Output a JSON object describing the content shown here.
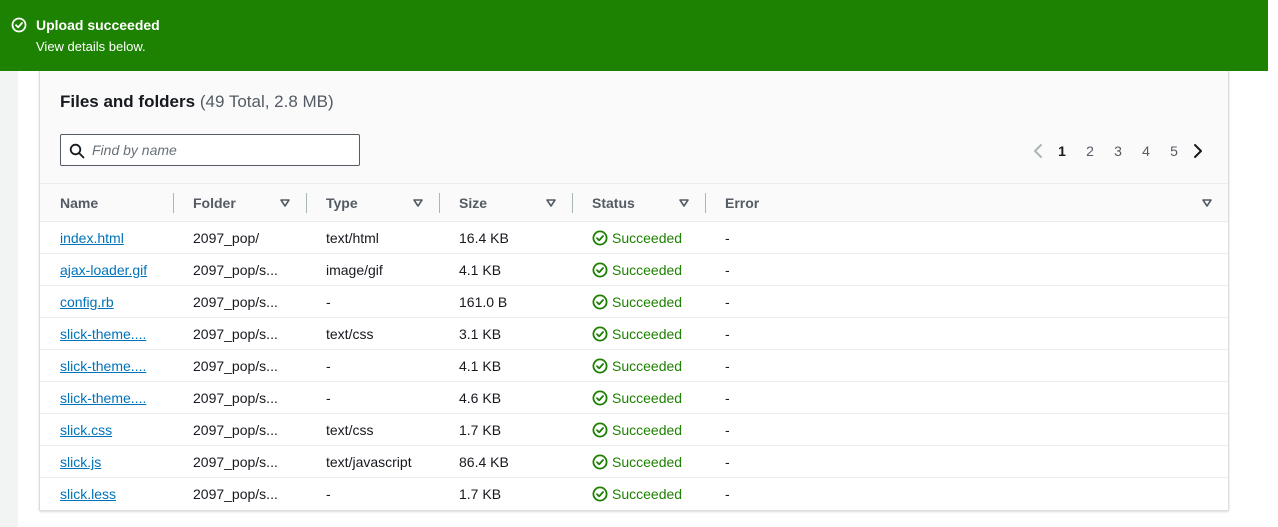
{
  "flash": {
    "title": "Upload succeeded",
    "description": "View details below.",
    "icon": "check-circle-icon",
    "color": "#1d8102"
  },
  "panel": {
    "title": "Files and folders",
    "count": "(49 Total, 2.8 MB)"
  },
  "search": {
    "placeholder": "Find by name",
    "value": ""
  },
  "pagination": {
    "pages": [
      "1",
      "2",
      "3",
      "4",
      "5"
    ],
    "current": "1",
    "prev_icon": "chevron-left-icon",
    "next_icon": "chevron-right-icon"
  },
  "table": {
    "columns": [
      "Name",
      "Folder",
      "Type",
      "Size",
      "Status",
      "Error"
    ],
    "rows": [
      {
        "name": "index.html",
        "folder": "2097_pop/",
        "type": "text/html",
        "size": "16.4 KB",
        "status": "Succeeded",
        "error": "-"
      },
      {
        "name": "ajax-loader.gif",
        "folder": "2097_pop/s...",
        "type": "image/gif",
        "size": "4.1 KB",
        "status": "Succeeded",
        "error": "-"
      },
      {
        "name": "config.rb",
        "folder": "2097_pop/s...",
        "type": "-",
        "size": "161.0 B",
        "status": "Succeeded",
        "error": "-"
      },
      {
        "name": "slick-theme....",
        "folder": "2097_pop/s...",
        "type": "text/css",
        "size": "3.1 KB",
        "status": "Succeeded",
        "error": "-"
      },
      {
        "name": "slick-theme....",
        "folder": "2097_pop/s...",
        "type": "-",
        "size": "4.1 KB",
        "status": "Succeeded",
        "error": "-"
      },
      {
        "name": "slick-theme....",
        "folder": "2097_pop/s...",
        "type": "-",
        "size": "4.6 KB",
        "status": "Succeeded",
        "error": "-"
      },
      {
        "name": "slick.css",
        "folder": "2097_pop/s...",
        "type": "text/css",
        "size": "1.7 KB",
        "status": "Succeeded",
        "error": "-"
      },
      {
        "name": "slick.js",
        "folder": "2097_pop/s...",
        "type": "text/javascript",
        "size": "86.4 KB",
        "status": "Succeeded",
        "error": "-"
      },
      {
        "name": "slick.less",
        "folder": "2097_pop/s...",
        "type": "-",
        "size": "1.7 KB",
        "status": "Succeeded",
        "error": "-"
      }
    ]
  },
  "colors": {
    "link": "#0073bb",
    "success": "#1d8102",
    "text": "#16191f",
    "muted": "#545b64"
  }
}
